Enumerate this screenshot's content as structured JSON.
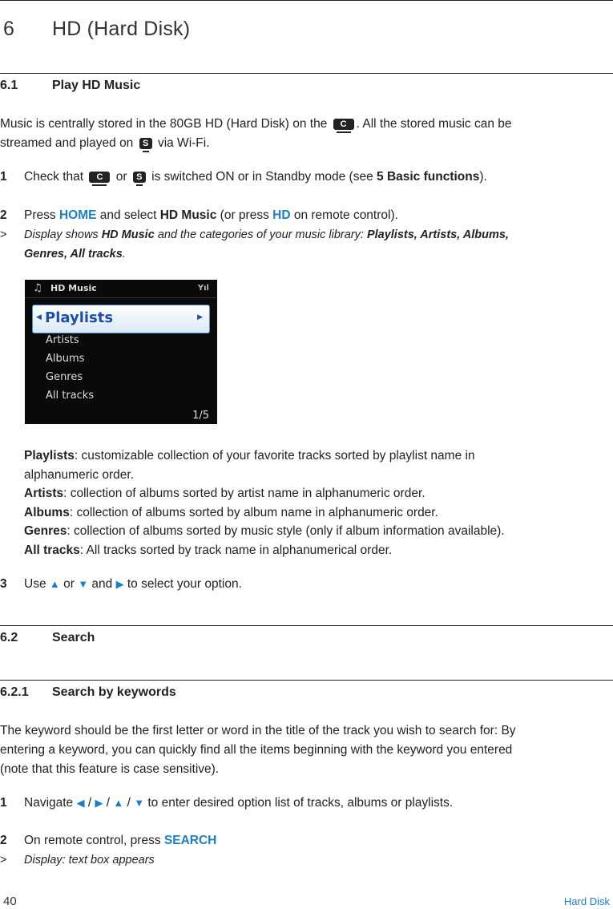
{
  "chapter": {
    "number": "6",
    "title": "HD (Hard Disk)"
  },
  "section_6_1": {
    "number": "6.1",
    "title": "Play HD Music",
    "intro_a": "Music is centrally stored in the 80GB HD (Hard Disk) on the",
    "intro_b": ". All the stored music can be",
    "intro_c": "streamed and played on",
    "intro_d": "via Wi-Fi.",
    "center_icon": "C",
    "station_icon": "S",
    "step1": {
      "num": "1",
      "a": "Check that",
      "or": "or",
      "b": "is switched ON or in Standby mode (see",
      "ref": "5 Basic functions",
      "c": ")."
    },
    "step2": {
      "num": "2",
      "a": "Press",
      "home": "HOME",
      "b": "and select",
      "hdmusic": "HD Music",
      "c": "(or press",
      "hd": "HD",
      "d": "on remote control)."
    },
    "result2": {
      "marker": ">",
      "a": "Display shows",
      "hdmusic": "HD Music",
      "b": "and the categories of your music library:",
      "cats": "Playlists, Artists, Albums,",
      "cats2": "Genres, All tracks",
      "end": "."
    },
    "screen": {
      "title": "HD Music",
      "selected": "Playlists",
      "items": [
        "Artists",
        "Albums",
        "Genres",
        "All tracks"
      ],
      "page": "1/5"
    },
    "definitions": [
      {
        "term": "Playlists",
        "text": ": customizable collection of your favorite tracks sorted by playlist name in",
        "text2": "alphanumeric order."
      },
      {
        "term": "Artists",
        "text": ": collection of albums sorted by artist name in alphanumeric order."
      },
      {
        "term": "Albums",
        "text": ": collection of albums sorted by album name in alphanumeric order."
      },
      {
        "term": "Genres",
        "text": ": collection of albums sorted by music style (only if album information available)."
      },
      {
        "term": "All tracks",
        "text": ": All tracks sorted by track name in alphanumerical order."
      }
    ],
    "step3": {
      "num": "3",
      "a": "Use",
      "or": "or",
      "and": "and",
      "b": "to select your option."
    }
  },
  "section_6_2": {
    "number": "6.2",
    "title": "Search"
  },
  "section_6_2_1": {
    "number": "6.2.1",
    "title": "Search by keywords",
    "p1": "The keyword should be the first letter or word in the title of the track you wish to search for: By",
    "p2": "entering a keyword, you can quickly find all the items beginning with the keyword you entered",
    "p3": "(note that this feature is case sensitive).",
    "step1": {
      "num": "1",
      "a": "Navigate",
      "sep": "/",
      "b": "to enter desired option list of tracks, albums or playlists."
    },
    "step2": {
      "num": "2",
      "a": "On remote control, press",
      "search": "SEARCH"
    },
    "result2": {
      "marker": ">",
      "text": "Display: text box appears"
    }
  },
  "footer": {
    "page": "40",
    "section": "Hard Disk"
  },
  "colors": {
    "accent": "#1a7fc8"
  }
}
